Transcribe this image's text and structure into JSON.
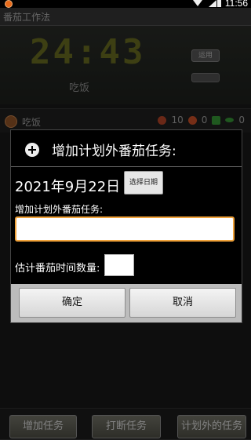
{
  "status": {
    "time": "11:56"
  },
  "app": {
    "title": "番茄工作法"
  },
  "timer": {
    "time": "24:43",
    "task": "吃饭",
    "button": "运用"
  },
  "task_row": {
    "name": "吃饭",
    "count_a": "10",
    "count_b": "0",
    "count_c": "0"
  },
  "dialog": {
    "title": "增加计划外番茄任务:",
    "date": "2021年9月22日",
    "pick_date_button": "选择日期",
    "task_label": "增加计划外番茄任务:",
    "task_value": "",
    "count_label": "估计番茄时间数量:",
    "count_value": "",
    "ok": "确定",
    "cancel": "取消"
  },
  "bottom": {
    "add": "增加任务",
    "interrupt": "打断任务",
    "unplanned": "计划外的任务"
  },
  "colors": {
    "accent": "#f0a23a",
    "timer_digits": "#6f7424"
  }
}
